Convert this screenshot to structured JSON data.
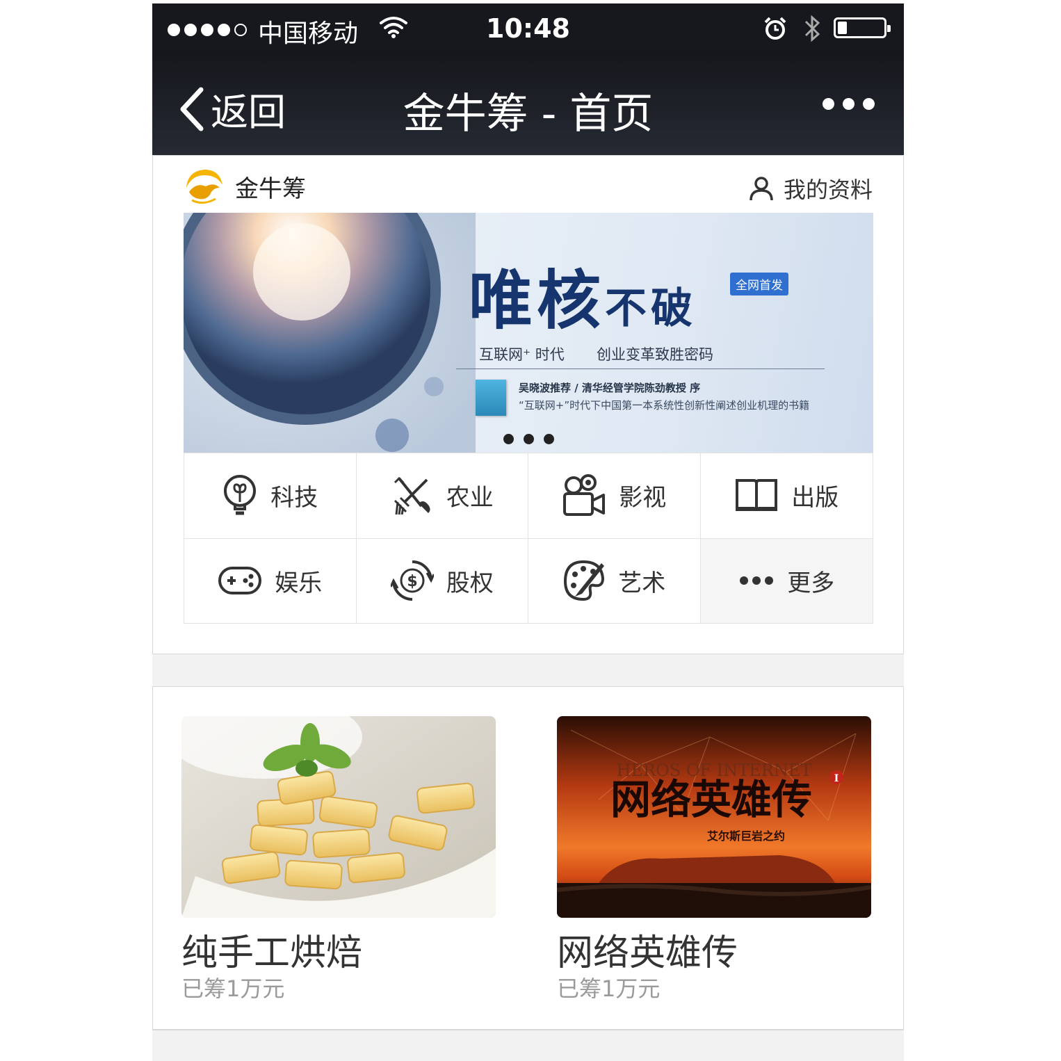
{
  "status_bar": {
    "carrier": "中国移动",
    "time": "10:48",
    "signal_bars": 4,
    "battery_level": 0.2
  },
  "nav": {
    "back_label": "返回",
    "title": "金牛筹 - 首页"
  },
  "header": {
    "brand_name": "金牛筹",
    "profile_label": "我的资料"
  },
  "banner": {
    "title_main": "唯核",
    "title_tail": "不破",
    "badge": "全网首发",
    "subtitle_left": "互联网⁺ 时代",
    "subtitle_right": "创业变革致胜密码",
    "recommendation": "吴晓波推荐 / 清华经管学院陈劲教授 序",
    "description": "“互联网+”时代下中国第一本系统性创新性阐述创业机理的书籍",
    "slide_count": 3
  },
  "categories": [
    {
      "label": "科技",
      "icon": "lightbulb-icon"
    },
    {
      "label": "农业",
      "icon": "farm-tools-icon"
    },
    {
      "label": "影视",
      "icon": "video-camera-icon"
    },
    {
      "label": "出版",
      "icon": "book-icon"
    },
    {
      "label": "娱乐",
      "icon": "gamepad-icon"
    },
    {
      "label": "股权",
      "icon": "dollar-cycle-icon"
    },
    {
      "label": "艺术",
      "icon": "palette-icon"
    },
    {
      "label": "更多",
      "icon": "more-dots-icon"
    }
  ],
  "projects": [
    {
      "title": "纯手工烘焙",
      "raised": "已筹1万元",
      "image": "baked-biscuits"
    },
    {
      "title": "网络英雄传",
      "raised": "已筹1万元",
      "image": "heroes-of-internet-poster",
      "poster_title": "网络英雄传",
      "poster_subtitle": "艾尔斯巨岩之约",
      "poster_en": "HEROS OF INTERNET",
      "poster_mark": "I"
    }
  ],
  "colors": {
    "nav_bg": "#16181d",
    "banner_title": "#16356e",
    "badge_bg": "#2f6fd0",
    "muted_text": "#9a9a9a"
  }
}
